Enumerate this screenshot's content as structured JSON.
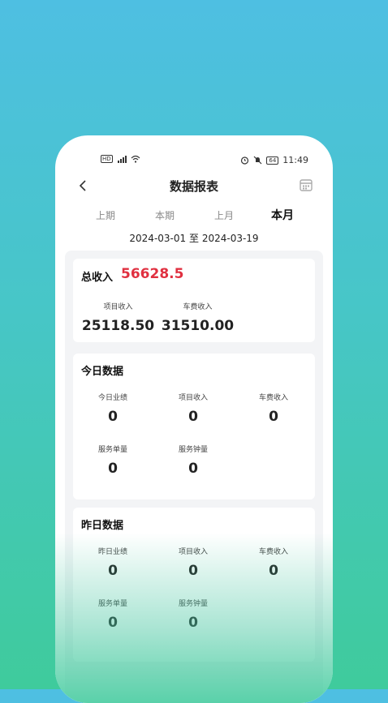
{
  "status_bar": {
    "time": "11:49",
    "battery": "64",
    "hd": "HD"
  },
  "nav": {
    "title": "数据报表"
  },
  "tabs": [
    {
      "label": "上期"
    },
    {
      "label": "本期"
    },
    {
      "label": "上月"
    },
    {
      "label": "本月"
    }
  ],
  "active_tab": "本月",
  "date_range": {
    "start": "2024-03-01",
    "sep": "至",
    "end": "2024-03-19"
  },
  "summary": {
    "title": "总收入",
    "total": "56628.5",
    "metrics": [
      {
        "label": "项目收入",
        "value": "25118.50"
      },
      {
        "label": "车费收入",
        "value": "31510.00"
      }
    ]
  },
  "today": {
    "title": "今日数据",
    "metrics": [
      {
        "label": "今日业绩",
        "value": "0"
      },
      {
        "label": "项目收入",
        "value": "0"
      },
      {
        "label": "车费收入",
        "value": "0"
      },
      {
        "label": "服务单量",
        "value": "0"
      },
      {
        "label": "服务钟量",
        "value": "0"
      }
    ]
  },
  "yesterday": {
    "title": "昨日数据",
    "metrics": [
      {
        "label": "昨日业绩",
        "value": "0"
      },
      {
        "label": "项目收入",
        "value": "0"
      },
      {
        "label": "车费收入",
        "value": "0"
      },
      {
        "label": "服务单量",
        "value": "0"
      },
      {
        "label": "服务钟量",
        "value": "0"
      }
    ]
  },
  "colors": {
    "accent_red": "#e03040",
    "bg_top": "#4ebfe2",
    "bg_bottom": "#3fcb9c"
  }
}
